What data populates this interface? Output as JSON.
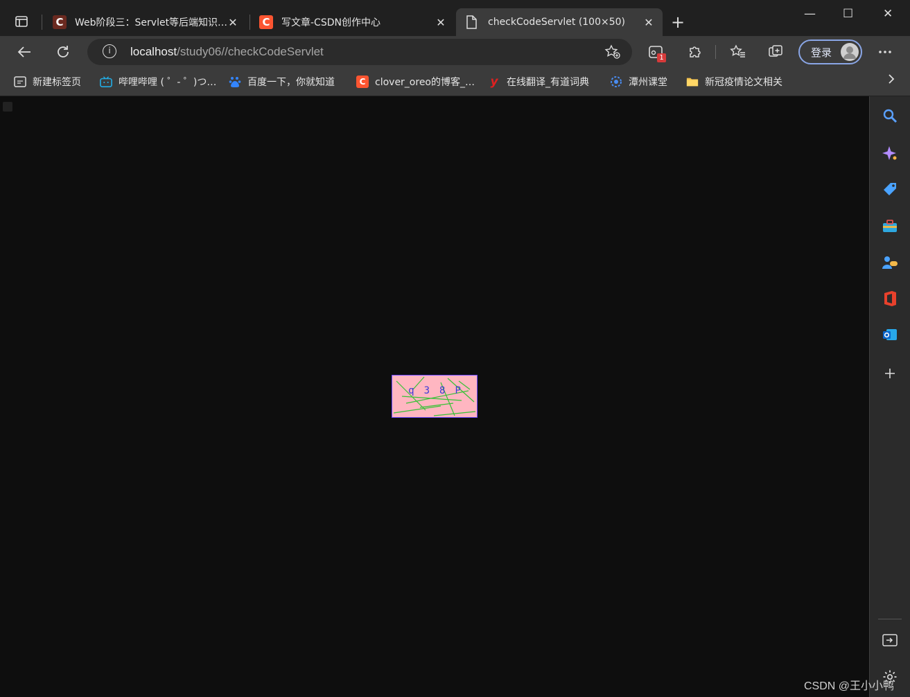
{
  "tabs": [
    {
      "title": "Web阶段三：Servlet等后端知识…",
      "favicon": "C",
      "active": false
    },
    {
      "title": "写文章-CSDN创作中心",
      "favicon": "C",
      "active": false
    },
    {
      "title": "checkCodeServlet (100×50)",
      "favicon": "page-icon",
      "active": true
    }
  ],
  "tab_close": "✕",
  "new_tab": "+",
  "window_controls": {
    "minimize": "—",
    "maximize": "☐",
    "close": "✕"
  },
  "address": {
    "host": "localhost",
    "path": "/study06//checkCodeServlet"
  },
  "extension_badge": "1",
  "login_label": "登录",
  "bookmarks": [
    {
      "label": "新建标签页",
      "icon": "newtab-icon"
    },
    {
      "label": "哔哩哔哩 ( ゜- ゜)つ…",
      "icon": "bilibili-icon"
    },
    {
      "label": "百度一下，你就知道",
      "icon": "baidu-icon"
    },
    {
      "label": "clover_oreo的博客_…",
      "icon": "C"
    },
    {
      "label": "在线翻译_有道词典",
      "icon": "y"
    },
    {
      "label": "潭州课堂",
      "icon": "tanzhou-icon"
    },
    {
      "label": "新冠疫情论文相关",
      "icon": "folder-icon"
    }
  ],
  "captcha": {
    "text": "q 3 8 P",
    "chars": [
      "q",
      "3",
      "8",
      "P"
    ],
    "background": "#ffb6c1",
    "text_color": "#3b3bd6",
    "line_color": "#36c236"
  },
  "watermark": "CSDN @王小小鸭",
  "colors": {
    "accent": "#8aa6e6",
    "csdn": "#fc5531",
    "content_bg": "#0e0e0e"
  }
}
